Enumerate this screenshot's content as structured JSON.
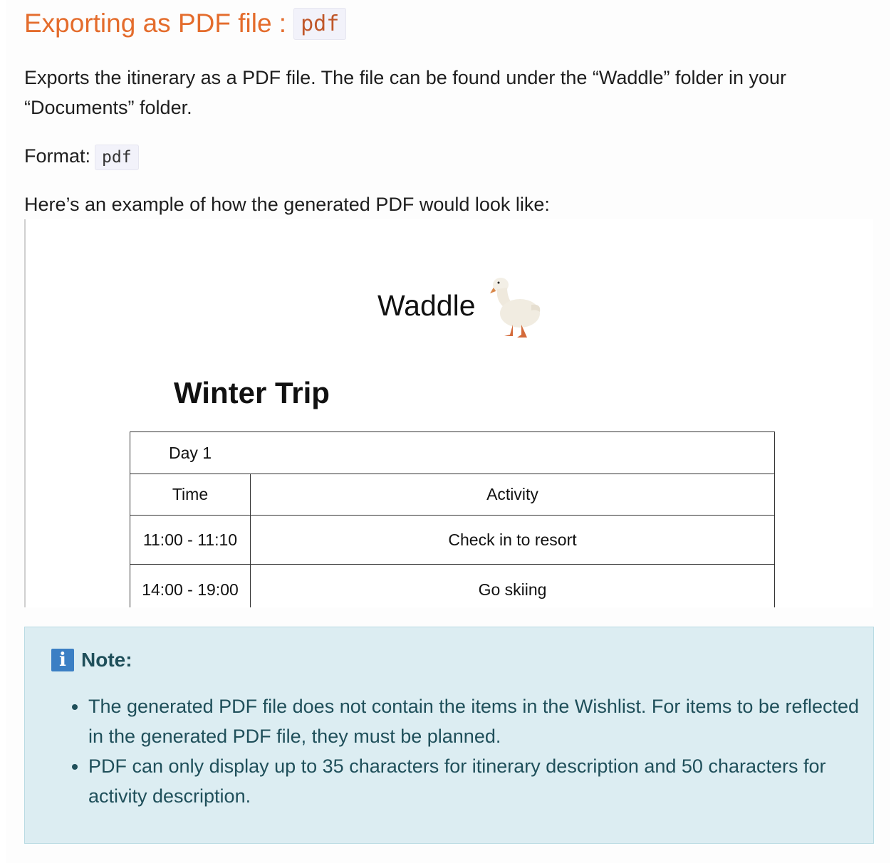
{
  "heading": {
    "text": "Exporting as PDF file :",
    "code": "pdf"
  },
  "description": "Exports the itinerary as a PDF file. The file can be found under the “Waddle” folder in your “Documents” folder.",
  "format": {
    "label": "Format:",
    "code": "pdf"
  },
  "example_intro": "Here’s an example of how the generated PDF would look like:",
  "pdf_example": {
    "app_name": "Waddle",
    "trip_title": "Winter Trip",
    "day_label": "Day 1",
    "columns": [
      "Time",
      "Activity"
    ],
    "rows": [
      {
        "time": "11:00 - 11:10",
        "activity": "Check in to resort"
      },
      {
        "time": "14:00 - 19:00",
        "activity": "Go skiing"
      }
    ]
  },
  "note": {
    "icon": "info-icon",
    "icon_glyph": "i",
    "title": "Note:",
    "items": [
      "The generated PDF file does not contain the items in the Wishlist. For items to be reflected in the generated PDF file, they must be planned.",
      "PDF can only display up to 35 characters for itinerary description and 50 characters for activity description."
    ]
  },
  "colors": {
    "heading": "#e46c2c",
    "note_background": "#dcedf2",
    "note_text": "#1f4f5a",
    "info_icon": "#3b7fc4"
  }
}
